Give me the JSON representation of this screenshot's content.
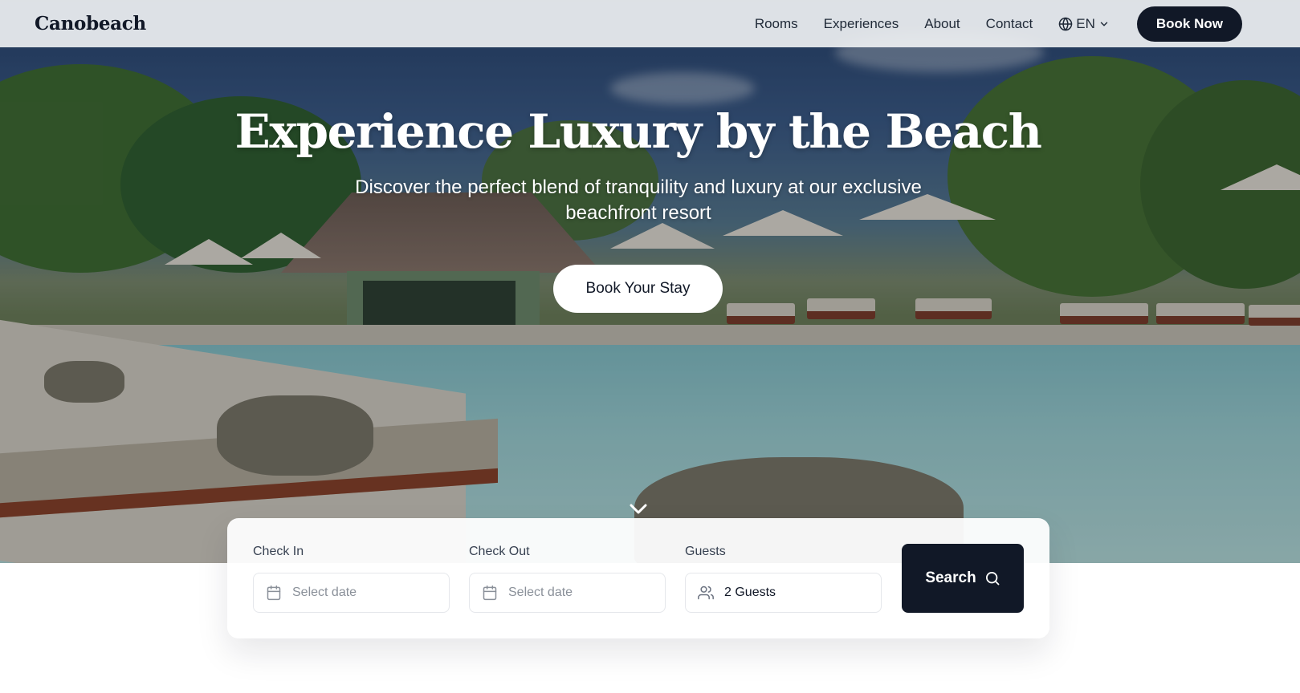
{
  "brand": {
    "name": "Canobeach"
  },
  "nav": {
    "links": [
      "Rooms",
      "Experiences",
      "About",
      "Contact"
    ],
    "language": {
      "label": "EN",
      "icon": "globe-icon"
    },
    "cta_label": "Book Now"
  },
  "hero": {
    "title": "Experience Luxury by the Beach",
    "subtitle": "Discover the perfect blend of tranquility and luxury at our exclusive beachfront resort",
    "cta_label": "Book Your Stay",
    "scroll_icon": "chevron-down-icon"
  },
  "booking": {
    "check_in": {
      "label": "Check In",
      "placeholder": "Select date",
      "icon": "calendar-icon"
    },
    "check_out": {
      "label": "Check Out",
      "placeholder": "Select date",
      "icon": "calendar-icon"
    },
    "guests": {
      "label": "Guests",
      "value": "2 Guests",
      "icon": "users-icon"
    },
    "search_label": "Search",
    "search_icon": "search-icon"
  },
  "colors": {
    "primary": "#111827",
    "navbar_bg": "#eef0f2",
    "pool": "#9fd3d4",
    "white": "#ffffff"
  }
}
